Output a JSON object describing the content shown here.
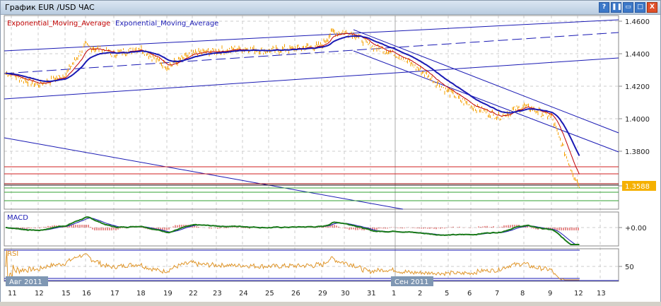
{
  "window": {
    "title": "График EUR /USD  ЧАС",
    "buttons": [
      "?",
      "❚❚",
      "▭",
      "□",
      "X"
    ]
  },
  "legend": {
    "ema_red": "Exponential_Moving_Average",
    "ema_blue": "Exponential_Moving_Average"
  },
  "colors": {
    "price": "#f5a000",
    "ema_red": "#c00000",
    "ema_blue": "#1a1ab4",
    "macd": "#1a7a1a",
    "rsi": "#e0962a"
  },
  "price_axis": {
    "labels": [
      "1.4600",
      "1.4400",
      "1.4200",
      "1.4000",
      "1.3800"
    ],
    "current": "1.3588"
  },
  "macd": {
    "label": "MACD",
    "axis": "+0.00"
  },
  "rsi": {
    "label": "RSI",
    "axis": "50"
  },
  "months": [
    "Авг 2011",
    "Сен 2011"
  ],
  "dates": [
    "11",
    "12",
    "15",
    "16",
    "17",
    "18",
    "19",
    "22",
    "23",
    "24",
    "25",
    "26",
    "29",
    "30",
    "31",
    "1",
    "2",
    "5",
    "6",
    "7",
    "8",
    "9",
    "12",
    "13"
  ],
  "chart_data": {
    "type": "line",
    "series_keypoints": [
      1.428,
      1.421,
      1.427,
      1.445,
      1.44,
      1.4435,
      1.432,
      1.44,
      1.4417,
      1.443,
      1.442,
      1.443,
      1.4448,
      1.4535,
      1.4525,
      1.4448,
      1.44,
      1.4296,
      1.4165,
      1.4078,
      1.4013,
      1.4078,
      1.4013,
      1.378,
      1.365,
      1.3588
    ]
  }
}
